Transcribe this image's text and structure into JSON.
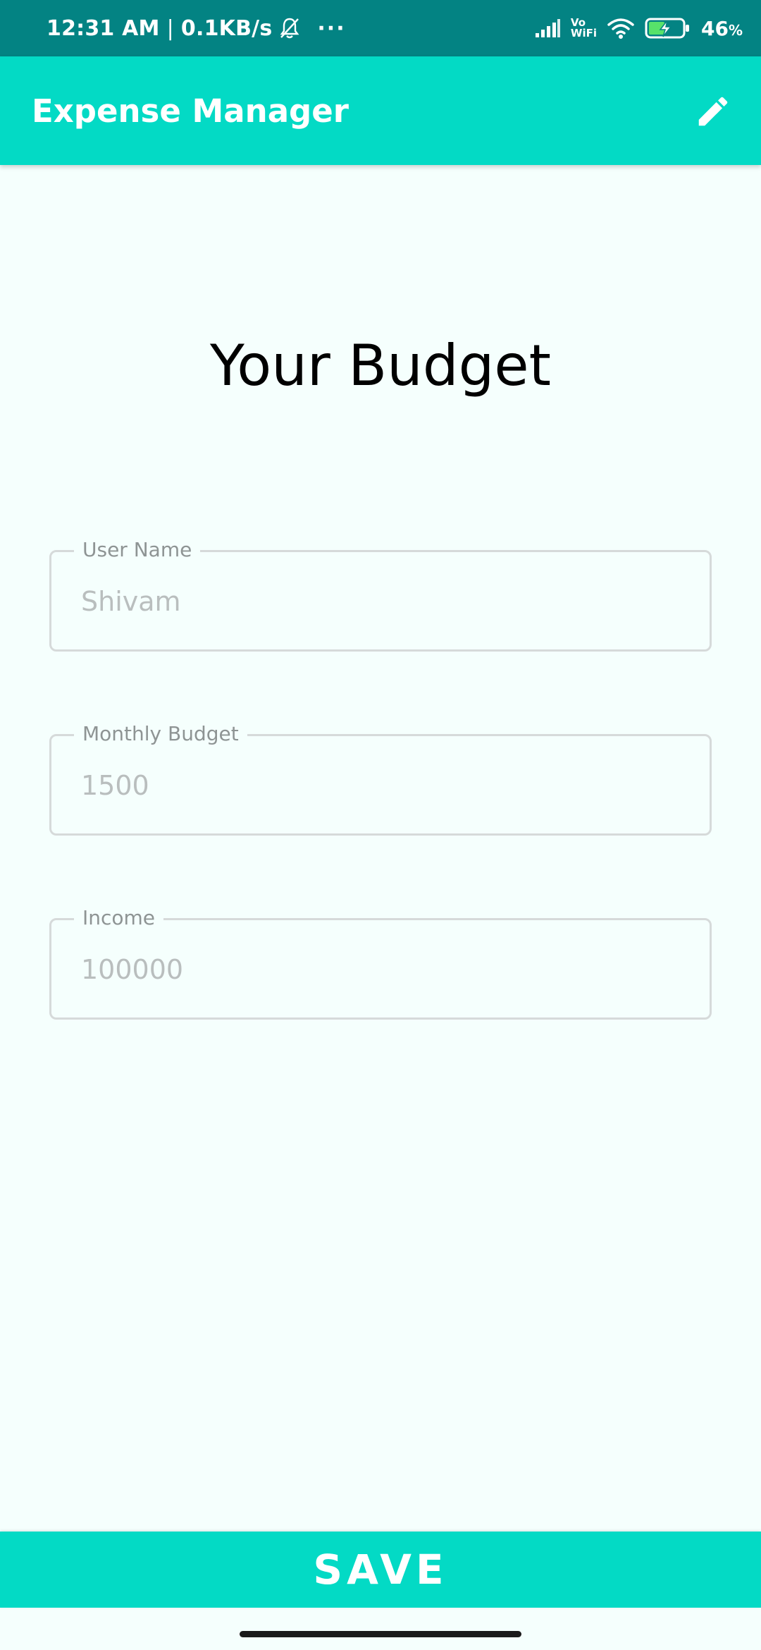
{
  "status_bar": {
    "time": "12:31 AM",
    "separator": "|",
    "net_speed": "0.1KB/s",
    "more": "···",
    "vowifi_top": "Vo",
    "vowifi_bottom": "WiFi",
    "battery_percent": "46",
    "percent_sign": "%",
    "icons": [
      "bell-off-icon",
      "signal-icon",
      "wifi-icon",
      "battery-charging-icon"
    ]
  },
  "app_bar": {
    "title": "Expense Manager",
    "action_icon": "edit-icon"
  },
  "main": {
    "heading": "Your Budget",
    "fields": [
      {
        "label": "User Name",
        "placeholder": "Shivam",
        "value": ""
      },
      {
        "label": "Monthly Budget",
        "placeholder": "1500",
        "value": ""
      },
      {
        "label": "Income",
        "placeholder": "100000",
        "value": ""
      }
    ]
  },
  "footer": {
    "save_label": "SAVE"
  },
  "colors": {
    "status_bar": "#038383",
    "accent": "#03DAC5",
    "background": "#F5FFFD",
    "field_border": "#D6DADA",
    "label_text": "#8E9494",
    "placeholder_text": "#B9BEBE"
  }
}
